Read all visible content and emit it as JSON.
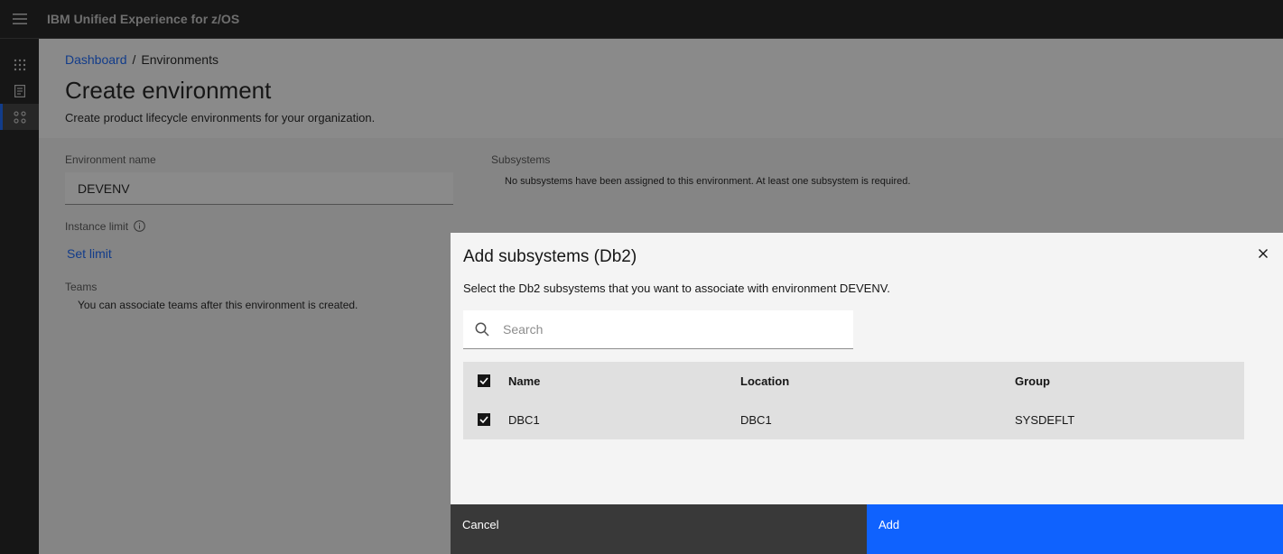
{
  "header": {
    "brand": "IBM",
    "product": "Unified Experience for z/OS"
  },
  "breadcrumb": {
    "parent": "Dashboard",
    "current": "Environments"
  },
  "page": {
    "title": "Create environment",
    "subtitle": "Create product lifecycle environments for your organization."
  },
  "form": {
    "env_name_label": "Environment name",
    "env_name_value": "DEVENV",
    "instance_limit_label": "Instance limit",
    "set_limit_link": "Set limit",
    "teams_label": "Teams",
    "teams_note": "You can associate teams after this environment is created.",
    "subsystems_label": "Subsystems",
    "subsystems_note": "No subsystems have been assigned to this environment. At least one subsystem is required."
  },
  "modal": {
    "title": "Add subsystems (Db2)",
    "description": "Select the Db2 subsystems that you want to associate with environment DEVENV.",
    "search_placeholder": "Search",
    "columns": [
      "Name",
      "Location",
      "Group"
    ],
    "rows": [
      {
        "name": "DBC1",
        "location": "DBC1",
        "group": "SYSDEFLT",
        "checked": true
      }
    ],
    "select_all_checked": true,
    "cancel_label": "Cancel",
    "add_label": "Add"
  },
  "icons": {
    "menu": "hamburger-menu-icon",
    "rail": [
      "app-switcher-icon",
      "document-icon",
      "environments-icon"
    ],
    "info": "info-icon",
    "search": "search-icon",
    "close": "close-icon"
  },
  "colors": {
    "accent": "#0f62fe",
    "header_bg": "#161616"
  }
}
